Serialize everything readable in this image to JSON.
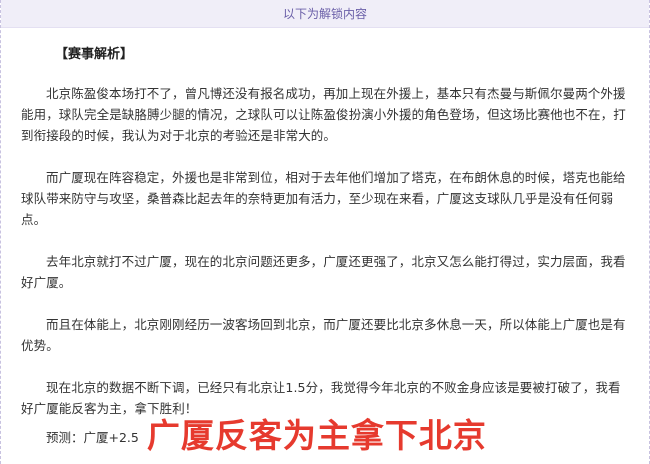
{
  "banner": {
    "label": "以下为解锁内容"
  },
  "article": {
    "heading": "【赛事解析】",
    "paragraphs": [
      "北京陈盈俊本场打不了，曾凡博还没有报名成功，再加上现在外援上，基本只有杰曼与斯佩尔曼两个外援能用，球队完全是缺胳膊少腿的情况，之球队可以让陈盈俊扮演小外援的角色登场，但这场比赛他也不在，打到衔接段的时候，我认为对于北京的考验还是非常大的。",
      "而广厦现在阵容稳定，外援也是非常到位，相对于去年他们增加了塔克，在布朗休息的时候，塔克也能给球队带来防守与攻坚，桑普森比起去年的奈特更加有活力，至少现在来看，广厦这支球队几乎是没有任何弱点。",
      "去年北京就打不过广厦，现在的北京问题还更多，广厦还更强了，北京又怎么能打得过，实力层面，我看好广厦。",
      "而且在体能上，北京刚刚经历一波客场回到北京，而广厦还要比北京多休息一天，所以体能上广厦也是有优势。",
      "现在北京的数据不断下调，已经只有北京让1.5分，我觉得今年北京的不败金身应该是要被打破了，我看好广厦能反客为主，拿下胜利！"
    ],
    "prediction": "预测：广厦+2.5",
    "overlay_caption": "广厦反客为主拿下北京"
  },
  "colors": {
    "banner_text": "#6a5fa8",
    "banner_bg": "#f0eef8",
    "body_text": "#333333",
    "overlay": "#e63a2e"
  }
}
